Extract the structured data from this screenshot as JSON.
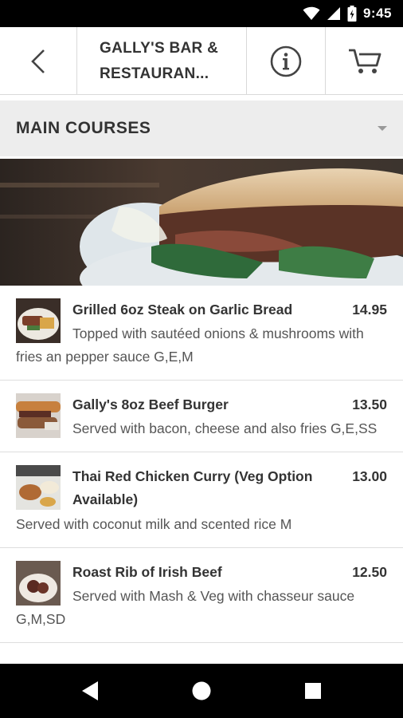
{
  "status_bar": {
    "time": "9:45",
    "icons": [
      "wifi-icon",
      "signal-icon",
      "battery-icon"
    ]
  },
  "toolbar": {
    "title": "GALLY'S BAR &\nRESTAURAN...",
    "back_icon": "back-arrow-icon",
    "info_icon": "info-icon",
    "cart_icon": "cart-icon"
  },
  "category": {
    "label": "MAIN COURSES",
    "dropdown_icon": "dropdown-triangle-icon"
  },
  "menu": {
    "items": [
      {
        "name": "Grilled 6oz Steak on Garlic Bread",
        "price": "14.95",
        "description": "Topped with sautéed onions & mushrooms with fries an pepper sauce G,E,M"
      },
      {
        "name": "Gally's 8oz Beef Burger",
        "price": "13.50",
        "description": "Served with bacon, cheese and also fries G,E,SS"
      },
      {
        "name": "Thai Red Chicken Curry (Veg Option Available)",
        "price": "13.00",
        "description": "Served with coconut milk and scented rice M"
      },
      {
        "name": "Roast Rib of Irish Beef",
        "price": "12.50",
        "description": "Served with Mash & Veg with chasseur sauce G,M,SD"
      }
    ]
  },
  "nav_bar": {
    "icons": [
      "nav-back-icon",
      "nav-home-icon",
      "nav-recents-icon"
    ]
  },
  "colors": {
    "toolbar_bg": "#ffffff",
    "category_bg": "#ededed",
    "status_bar_bg": "#000000",
    "text": "#333333"
  }
}
